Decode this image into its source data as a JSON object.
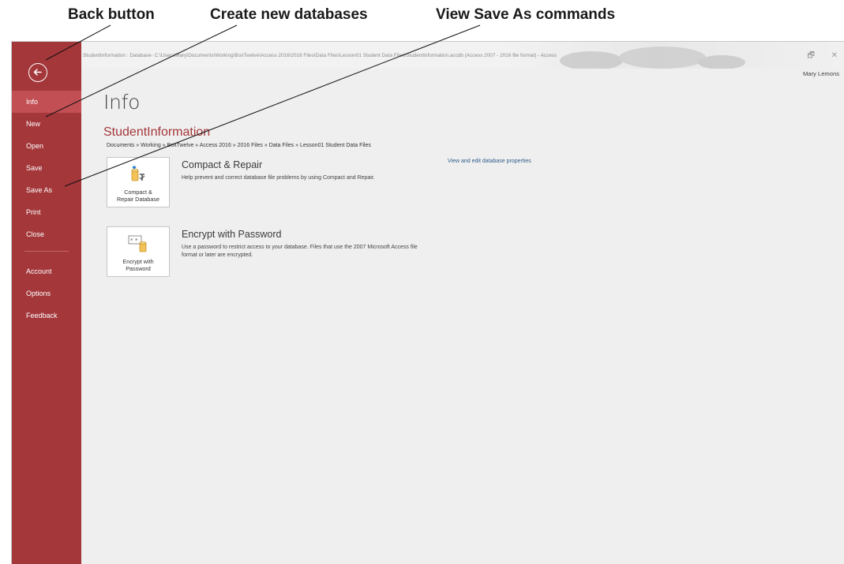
{
  "callouts": {
    "back": "Back button",
    "new": "Create new databases",
    "save_as": "View Save As commands"
  },
  "titlebar": {
    "path": "StudentInformation : Database- C:\\Users\\Mary\\Documents\\Working\\BoxTwelve\\Access 2016\\2016 Files\\Data Files\\Lesson01 Student Data Files\\StudentInformation.accdb (Access 2007 - 2016 file format) - Access",
    "restore_glyph": "🗗",
    "close_glyph": "✕",
    "user": "Mary Lemons"
  },
  "sidebar": {
    "back_icon": "arrow-left-circle-icon",
    "items": [
      {
        "label": "Info",
        "active": true
      },
      {
        "label": "New"
      },
      {
        "label": "Open"
      },
      {
        "label": "Save"
      },
      {
        "label": "Save As"
      },
      {
        "label": "Print"
      },
      {
        "label": "Close"
      },
      {
        "label": "Account"
      },
      {
        "label": "Options"
      },
      {
        "label": "Feedback"
      }
    ]
  },
  "main": {
    "title": "Info",
    "db_name": "StudentInformation",
    "breadcrumb": "Documents » Working » BoxTwelve » Access 2016 » 2016 Files » Data Files » Lesson01 Student Data Files",
    "properties_link": "View and edit database properties",
    "compact": {
      "button_line1": "Compact &",
      "button_line2": "Repair Database",
      "title": "Compact & Repair",
      "description": "Help prevent and correct database file problems by using Compact and Repair."
    },
    "encrypt": {
      "button_line1": "Encrypt with",
      "button_line2": "Password",
      "title": "Encrypt with Password",
      "description": "Use a password to restrict access to your database. Files that use the 2007 Microsoft Access file format or later are encrypted."
    }
  },
  "colors": {
    "sidebar": "#a4373a",
    "active_item": "#c24f54",
    "accent_text": "#a4373a",
    "link": "#2e5d8a"
  }
}
